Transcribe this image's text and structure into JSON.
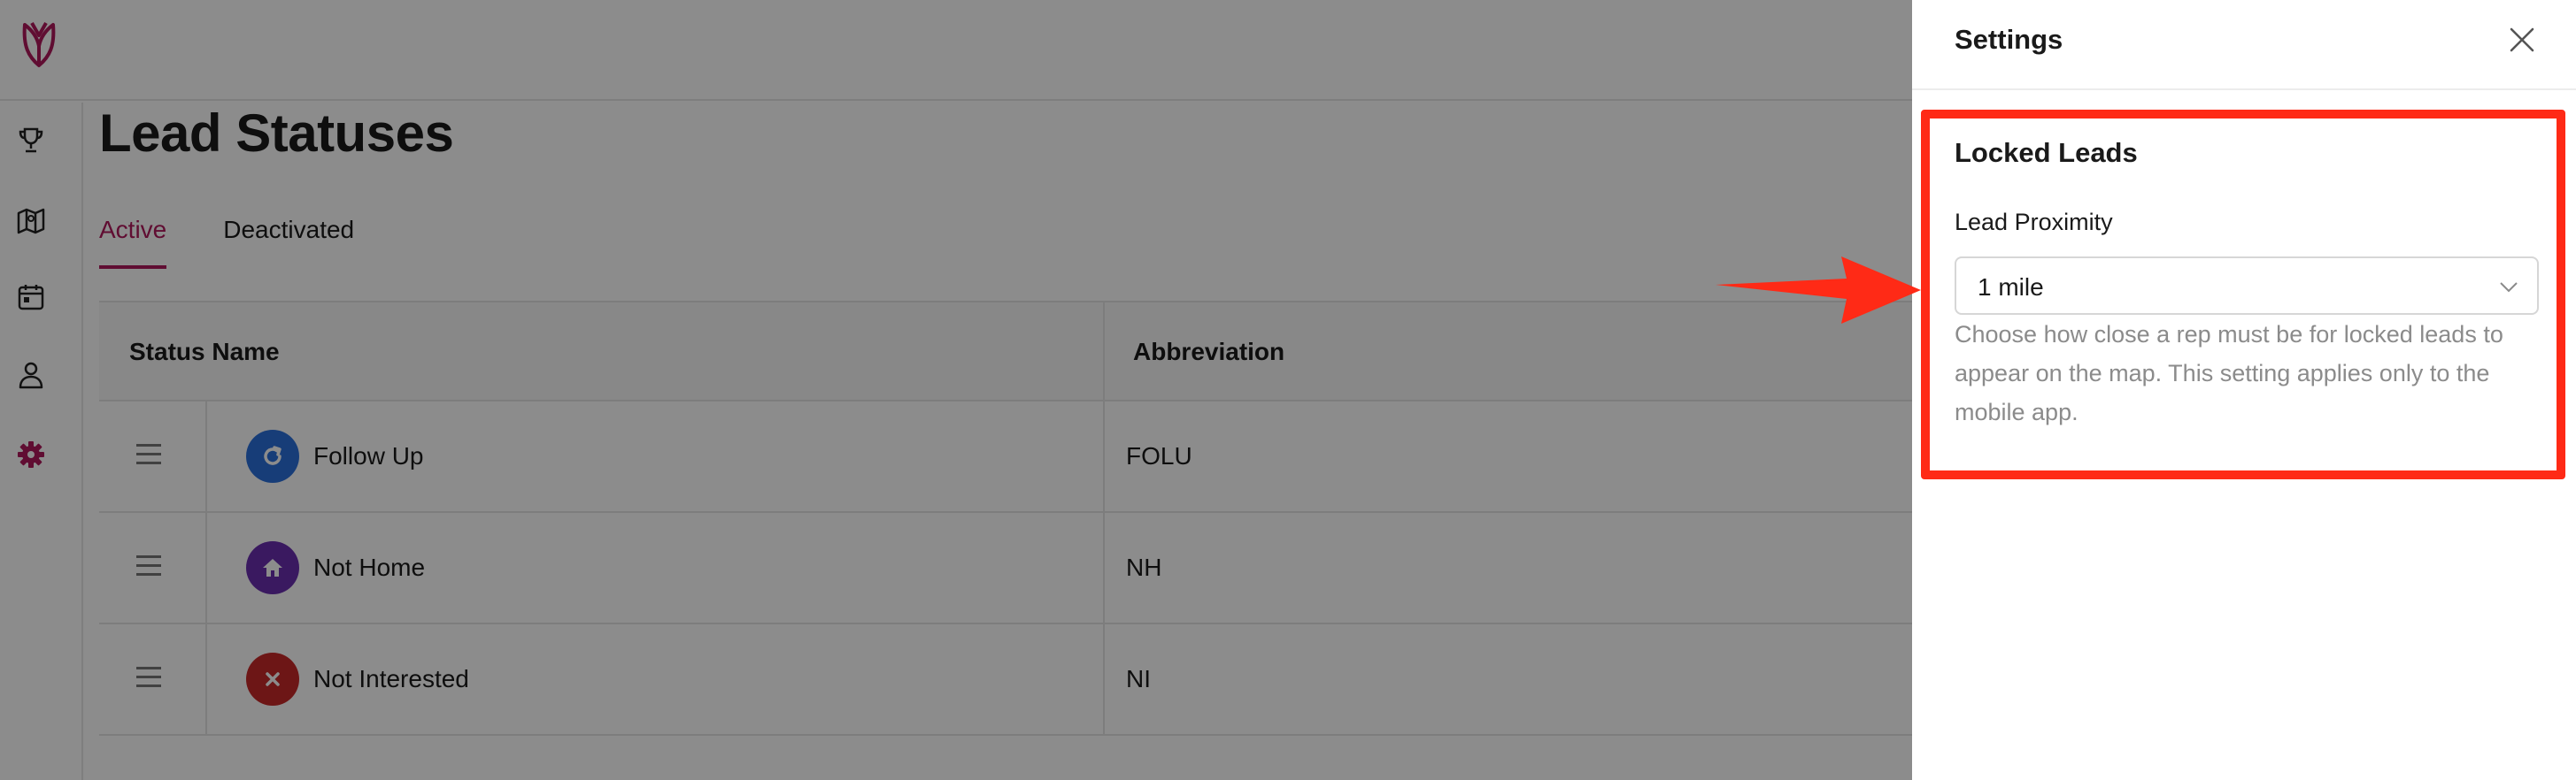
{
  "page": {
    "title": "Lead Statuses",
    "tabs": [
      {
        "label": "Active",
        "selected": true
      },
      {
        "label": "Deactivated",
        "selected": false
      }
    ]
  },
  "sidebar": {
    "items": [
      {
        "icon": "trophy-icon",
        "active": false
      },
      {
        "icon": "map-icon",
        "active": false
      },
      {
        "icon": "calendar-icon",
        "active": false
      },
      {
        "icon": "person-icon",
        "active": false
      },
      {
        "icon": "gear-icon",
        "active": true
      }
    ],
    "accent_color": "#b0185c"
  },
  "table": {
    "columns": [
      "Status Name",
      "Abbreviation"
    ],
    "rows": [
      {
        "name": "Follow Up",
        "abbr": "FOLU",
        "icon": "refresh-icon",
        "color": "#2a6fdb"
      },
      {
        "name": "Not Home",
        "abbr": "NH",
        "icon": "house-icon",
        "color": "#6a2fb0"
      },
      {
        "name": "Not Interested",
        "abbr": "NI",
        "icon": "x-icon",
        "color": "#c62828"
      }
    ]
  },
  "drawer": {
    "title": "Settings",
    "section_title": "Locked Leads",
    "field_label": "Lead Proximity",
    "select_value": "1 mile",
    "help_text": "Choose how close a rep must be for locked leads to appear on the map. This setting applies only to the mobile app."
  },
  "annotation": {
    "highlight_color": "#ff2a16"
  }
}
